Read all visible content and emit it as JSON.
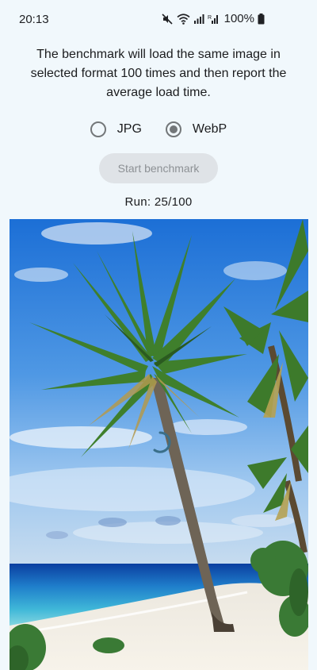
{
  "status_bar": {
    "time": "20:13",
    "battery": "100%",
    "icons": [
      "mute-icon",
      "wifi-icon",
      "signal-icon",
      "signal-r-icon",
      "battery-icon"
    ]
  },
  "description": "The benchmark will load the same image in selected format 100 times and then report the average load time.",
  "format_options": [
    {
      "label": "JPG",
      "selected": false
    },
    {
      "label": "WebP",
      "selected": true
    }
  ],
  "start_button": {
    "label": "Start benchmark",
    "enabled": false
  },
  "run_status": "Run: 25/100",
  "progress": {
    "current": 25,
    "total": 100
  },
  "colors": {
    "background": "#f1f8fc",
    "button_disabled_bg": "#dfe3e7",
    "button_disabled_text": "#8d9195",
    "radio": "#737779",
    "spinner": "#3a6f8a"
  },
  "image": {
    "icon": "beach-palm-image",
    "loading": true
  }
}
